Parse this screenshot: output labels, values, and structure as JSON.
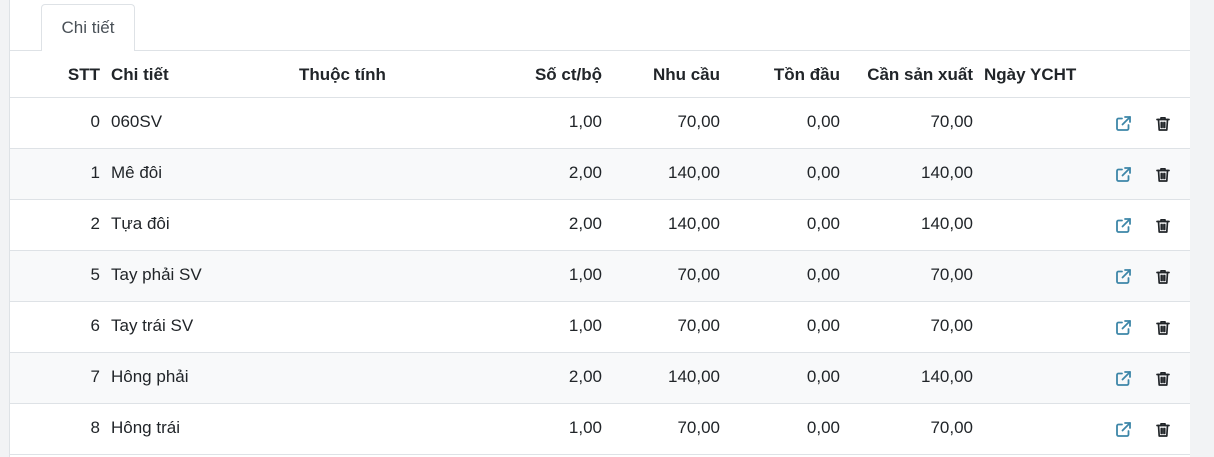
{
  "tabs": [
    {
      "label": "Chi tiết"
    }
  ],
  "table": {
    "headers": {
      "stt": "STT",
      "name": "Chi tiết",
      "attr": "Thuộc tính",
      "soct": "Số ct/bộ",
      "nhucau": "Nhu cầu",
      "tondau": "Tồn đầu",
      "cansx": "Cần sản xuất",
      "ngay": "Ngày YCHT"
    },
    "rows": [
      {
        "stt": "0",
        "name": "060SV",
        "attr": "",
        "soct": "1,00",
        "nhucau": "70,00",
        "tondau": "0,00",
        "cansx": "70,00",
        "ngay": ""
      },
      {
        "stt": "1",
        "name": "Mê đôi",
        "attr": "",
        "soct": "2,00",
        "nhucau": "140,00",
        "tondau": "0,00",
        "cansx": "140,00",
        "ngay": ""
      },
      {
        "stt": "2",
        "name": "Tựa đôi",
        "attr": "",
        "soct": "2,00",
        "nhucau": "140,00",
        "tondau": "0,00",
        "cansx": "140,00",
        "ngay": ""
      },
      {
        "stt": "5",
        "name": "Tay phải SV",
        "attr": "",
        "soct": "1,00",
        "nhucau": "70,00",
        "tondau": "0,00",
        "cansx": "70,00",
        "ngay": ""
      },
      {
        "stt": "6",
        "name": "Tay trái SV",
        "attr": "",
        "soct": "1,00",
        "nhucau": "70,00",
        "tondau": "0,00",
        "cansx": "70,00",
        "ngay": ""
      },
      {
        "stt": "7",
        "name": "Hông phải",
        "attr": "",
        "soct": "2,00",
        "nhucau": "140,00",
        "tondau": "0,00",
        "cansx": "140,00",
        "ngay": ""
      },
      {
        "stt": "8",
        "name": "Hông trái",
        "attr": "",
        "soct": "1,00",
        "nhucau": "70,00",
        "tondau": "0,00",
        "cansx": "70,00",
        "ngay": ""
      }
    ],
    "row_actions": {
      "open_icon": "external-link-icon",
      "delete_icon": "trash-icon"
    }
  },
  "colors": {
    "open_icon": "#3d86a8",
    "delete_icon": "#212529",
    "border": "#dee2e6",
    "row_alt": "#f8f9fa"
  }
}
